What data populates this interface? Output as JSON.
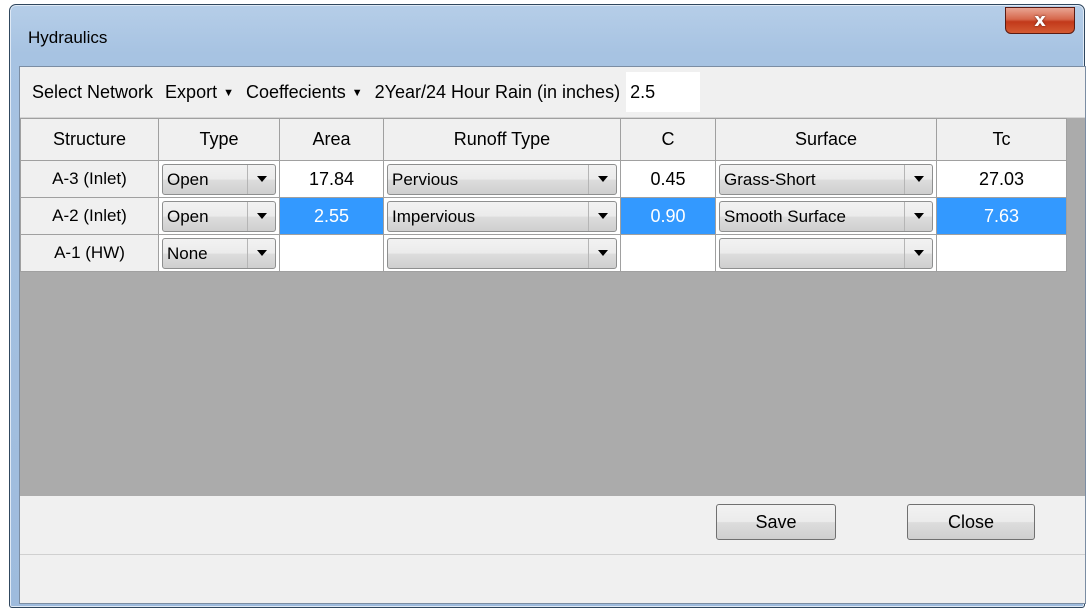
{
  "window": {
    "title": "Hydraulics",
    "close_glyph": "x"
  },
  "menu": {
    "select_network": "Select Network",
    "export": "Export",
    "coefficients": "Coeffecients",
    "rain_label": "2Year/24 Hour Rain (in inches)",
    "rain_value": "2.5",
    "caret_icon": "dropdown-caret"
  },
  "grid": {
    "columns": [
      "Structure",
      "Type",
      "Area",
      "Runoff Type",
      "C",
      "Surface",
      "Tc"
    ],
    "rows": [
      {
        "structure": "A-3 (Inlet)",
        "type": "Open",
        "area": "17.84",
        "runoff_type": "Pervious",
        "c": "0.45",
        "surface": "Grass-Short",
        "tc": "27.03",
        "selected": false
      },
      {
        "structure": "A-2 (Inlet)",
        "type": "Open",
        "area": "2.55",
        "runoff_type": "Impervious",
        "c": "0.90",
        "surface": "Smooth Surface",
        "tc": "7.63",
        "selected": true
      },
      {
        "structure": "A-1 (HW)",
        "type": "None",
        "area": "",
        "runoff_type": "",
        "c": "",
        "surface": "",
        "tc": "",
        "selected": false
      }
    ]
  },
  "buttons": {
    "save": "Save",
    "close": "Close"
  },
  "colors": {
    "selection": "#3399ff",
    "grid_background": "#ababab",
    "window_frame": "#a7c3e2",
    "close_button": "#c2391b"
  }
}
